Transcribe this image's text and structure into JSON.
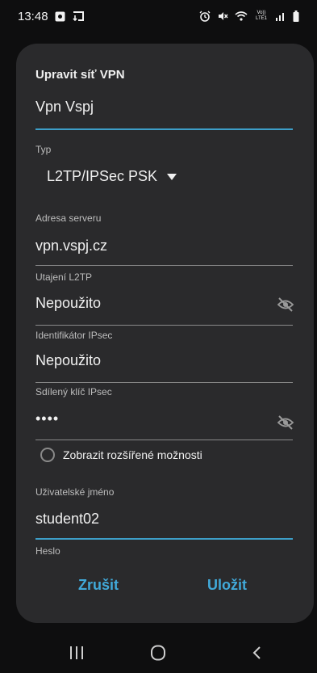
{
  "status_bar": {
    "time": "13:48",
    "left_icons": [
      "gallery-icon",
      "data-transfer-icon"
    ],
    "right_icons": [
      "alarm-icon",
      "mute-icon",
      "wifi-icon",
      "volte-icon",
      "signal-icon",
      "battery-icon"
    ],
    "volte_text": "Vo)) LTE1"
  },
  "dialog": {
    "title": "Upravit síť VPN",
    "name_value": "Vpn Vspj",
    "type": {
      "label": "Typ",
      "value": "L2TP/IPSec PSK"
    },
    "server": {
      "label": "Adresa serveru",
      "value": "vpn.vspj.cz"
    },
    "l2tp_secret": {
      "label": "Utajení L2TP",
      "value": "Nepoužito"
    },
    "ipsec_id": {
      "label": "Identifikátor IPsec",
      "value": "Nepoužito"
    },
    "ipsec_key": {
      "label": "Sdílený klíč IPsec",
      "value": "••••"
    },
    "advanced_option": "Zobrazit rozšířené možnosti",
    "username": {
      "label": "Uživatelské jméno",
      "value": "student02"
    },
    "password": {
      "label": "Heslo"
    },
    "cancel_label": "Zrušit",
    "save_label": "Uložit"
  },
  "colors": {
    "accent": "#41a9d9",
    "background": "#0e0e0f",
    "dialog": "#2a2a2c"
  }
}
